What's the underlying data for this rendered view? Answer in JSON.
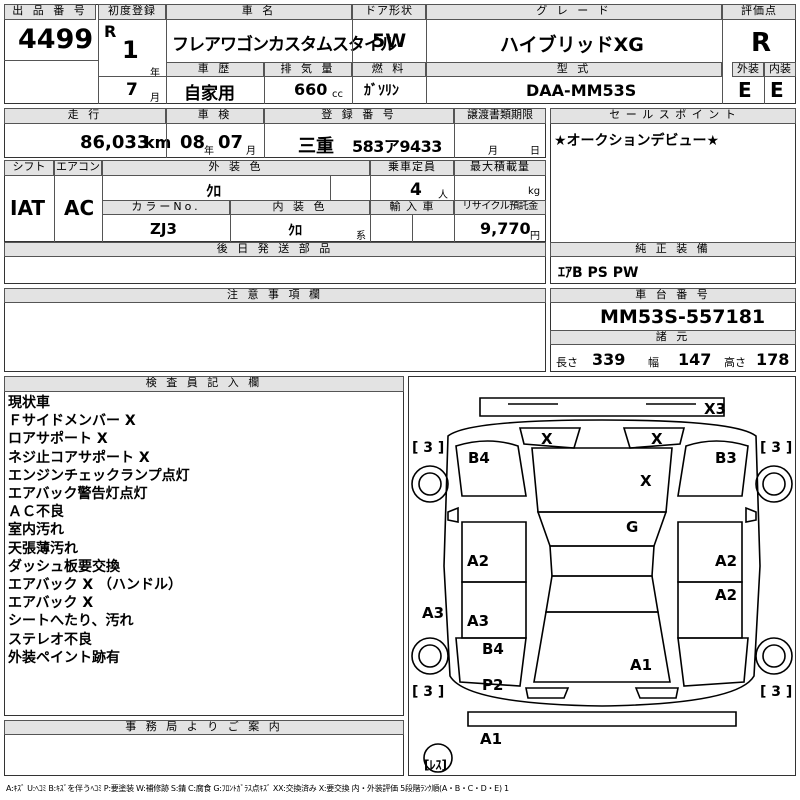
{
  "header": {
    "lot_no_label": "出 品 番 号",
    "lot_no": "4499",
    "first_reg_label": "初度登録",
    "era": "R",
    "reg_year": "1",
    "year_unit": "年",
    "reg_month": "7",
    "month_unit": "月",
    "car_name_label": "車 名",
    "car_name": "フレアワゴンカスタムスタイル",
    "door_label": "ドア形状",
    "door": "5W",
    "grade_label": "グ レ ー ド",
    "grade": "ハイブリッドXG",
    "score_label": "評価点",
    "score": "R",
    "history_label": "車 歴",
    "history": "自家用",
    "displacement_label": "排 気 量",
    "displacement": "660",
    "displacement_unit": "cc",
    "fuel_label": "燃 料",
    "fuel": "ｶﾞｿﾘﾝ",
    "model_label": "型 式",
    "model": "DAA-MM53S",
    "ext_label": "外装",
    "ext_grade": "E",
    "int_label": "内装",
    "int_grade": "E"
  },
  "row2": {
    "mileage_label": "走 行",
    "mileage": "86,033",
    "mileage_unit": "km",
    "inspection_label": "車 検",
    "insp_year": "08",
    "year_unit": "年",
    "insp_month": "07",
    "month_unit": "月",
    "plate_label": "登 録 番 号",
    "plate_pref": "三重",
    "plate_num": "583ア9433",
    "transfer_label": "譲渡書類期限",
    "transfer_month_unit": "月",
    "transfer_day_unit": "日",
    "sales_point_label": "セ ー ル ス ポ イ ン ト",
    "sales_point": "★オークションデビュー★"
  },
  "row3": {
    "shift_label": "シフト",
    "shift": "IAT",
    "ac_label": "エアコン",
    "ac": "AC",
    "ext_color_label": "外 装 色",
    "ext_color": "ｸﾛ",
    "capacity_label": "乗車定員",
    "capacity": "4",
    "capacity_unit": "人",
    "max_load_label": "最大積載量",
    "max_load_unit": "kg",
    "color_no_label": "カラーNo.",
    "color_no": "ZJ3",
    "int_color_label": "内 装 色",
    "int_color": "ｸﾛ",
    "int_color_unit": "系",
    "import_label": "輸 入 車",
    "recycle_label": "リサイクル預託金",
    "recycle": "9,770",
    "recycle_unit": "円"
  },
  "later_parts_label": "後 日 発 送 部 品",
  "equipment": {
    "label": "純 正 装 備",
    "value": "ｴｱB PS PW"
  },
  "notes_label": "注 意 事 項 欄",
  "chassis": {
    "label": "車 台 番 号",
    "value": "MM53S-557181",
    "dims_label": "諸 元",
    "length_label": "長さ",
    "length": "339",
    "width_label": "幅",
    "width": "147",
    "height_label": "高さ",
    "height": "178"
  },
  "inspector": {
    "label": "検 査 員 記 入 欄",
    "lines": [
      "現状車",
      "Ｆサイドメンバー X",
      "ロアサポート X",
      "ネジ止コアサポート X",
      "エンジンチェックランプ点灯",
      "エアバック警告灯点灯",
      "ＡＣ不良",
      "室内汚れ",
      "天張薄汚れ",
      "ダッシュ板要交換",
      "エアバック X （ハンドル）",
      "エアバック X",
      "シートへたり、汚れ",
      "ステレオ不良",
      "外装ペイント跡有"
    ]
  },
  "office_label": "事 務 局 よ り ご 案 内",
  "diagram": {
    "marks": {
      "x3": "X3",
      "front_glass_left": "X",
      "front_glass_right": "X",
      "hood": "X",
      "roof": "G",
      "b4_top": "B4",
      "b3_top": "B3",
      "a2_left": "A2",
      "a2_right": "A2",
      "a2_right2": "A2",
      "a3_left": "A3",
      "a3_center": "A3",
      "b4_bottom": "B4",
      "a1_center": "A1",
      "p2": "P2",
      "a1_bottom": "A1"
    },
    "tire_tl": "[ 3 ]",
    "tire_tr": "[ 3 ]",
    "tire_bl": "[ 3 ]",
    "tire_br": "[ 3 ]",
    "spare": "[ﾚｽ]"
  },
  "legend": "A:ｷｽﾞ U:ﾍｺﾐ B:ｷｽﾞを伴うﾍｺﾐ P:要塗装 W:補修跡 S:錆 C:腐食 G:ﾌﾛﾝﾄｶﾞﾗｽ点ｷｽﾞ XX:交換済み X:要交換 内・外装評価 5段階ﾗﾝｸ順(A・B・C・D・E) 1"
}
